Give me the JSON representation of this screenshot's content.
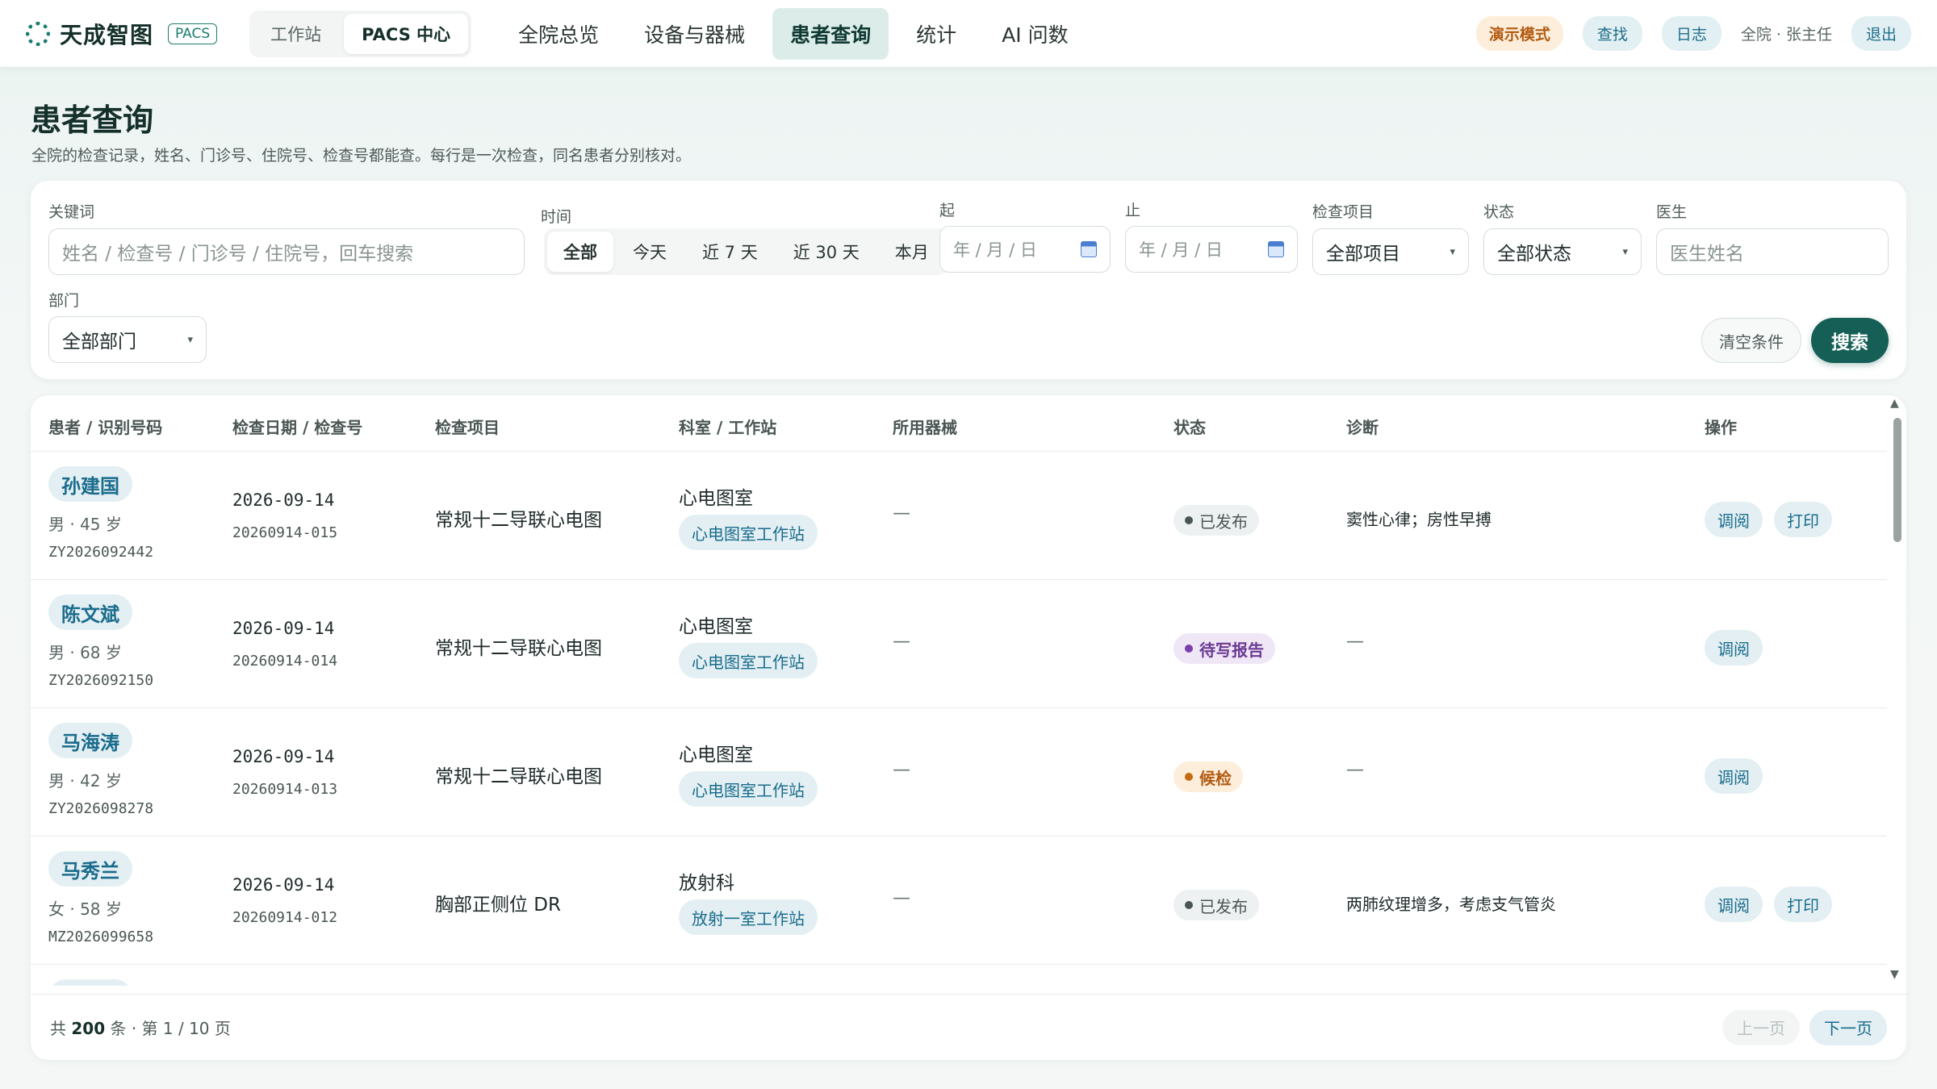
{
  "topbar": {
    "brand": "天成智图",
    "brand_tag": "PACS",
    "modes": [
      "工作站",
      "PACS 中心"
    ],
    "nav": [
      "全院总览",
      "设备与器械",
      "患者查询",
      "统计",
      "AI 问数"
    ],
    "demo_badge": "演示模式",
    "find": "查找",
    "log": "日志",
    "user": "全院 · 张主任",
    "logout": "退出"
  },
  "header": {
    "title": "患者查询",
    "subtitle": "全院的检查记录，姓名、门诊号、住院号、检查号都能查。每行是一次检查，同名患者分别核对。"
  },
  "filters": {
    "keyword_label": "关键词",
    "keyword_placeholder": "姓名 / 检查号 / 门诊号 / 住院号，回车搜索",
    "time_label": "时间",
    "time_options": [
      "全部",
      "今天",
      "近 7 天",
      "近 30 天",
      "本月"
    ],
    "time_selected": "全部",
    "from_label": "起",
    "to_label": "止",
    "date_placeholder": "年 / 月 / 日",
    "exam_label": "检查项目",
    "exam_value": "全部项目",
    "status_label": "状态",
    "status_value": "全部状态",
    "doctor_label": "医生",
    "doctor_placeholder": "医生姓名",
    "dept_label": "部门",
    "dept_value": "全部部门",
    "clear": "清空条件",
    "search": "搜索"
  },
  "table": {
    "headers": [
      "患者 / 识别号码",
      "检查日期 / 检查号",
      "检查项目",
      "科室 / 工作站",
      "所用器械",
      "状态",
      "诊断",
      "操作"
    ],
    "rows": [
      {
        "name": "孙建国",
        "meta": "男 · 45 岁",
        "pid": "ZY2026092442",
        "date": "2026-09-14",
        "exam_no": "20260914-015",
        "item": "常规十二导联心电图",
        "dept": "心电图室",
        "ws": "心电图室工作站",
        "device": "—",
        "status": "已发布",
        "diag": "窦性心律；房性早搏",
        "actions": [
          "调阅",
          "打印"
        ]
      },
      {
        "name": "陈文斌",
        "meta": "男 · 68 岁",
        "pid": "ZY2026092150",
        "date": "2026-09-14",
        "exam_no": "20260914-014",
        "item": "常规十二导联心电图",
        "dept": "心电图室",
        "ws": "心电图室工作站",
        "device": "—",
        "status": "待写报告",
        "diag": "—",
        "actions": [
          "调阅"
        ]
      },
      {
        "name": "马海涛",
        "meta": "男 · 42 岁",
        "pid": "ZY2026098278",
        "date": "2026-09-14",
        "exam_no": "20260914-013",
        "item": "常规十二导联心电图",
        "dept": "心电图室",
        "ws": "心电图室工作站",
        "device": "—",
        "status": "候检",
        "diag": "—",
        "actions": [
          "调阅"
        ]
      },
      {
        "name": "马秀兰",
        "meta": "女 · 58 岁",
        "pid": "MZ2026099658",
        "date": "2026-09-14",
        "exam_no": "20260914-012",
        "item": "胸部正侧位 DR",
        "dept": "放射科",
        "ws": "放射一室工作站",
        "device": "—",
        "status": "已发布",
        "diag": "两肺纹理增多，考虑支气管炎",
        "actions": [
          "调阅",
          "打印"
        ]
      }
    ]
  },
  "footer": {
    "total_prefix": "共",
    "total_count": "200",
    "total_suffix": "条 · 第 1 / 10 页",
    "prev": "上一页",
    "next": "下一页"
  }
}
